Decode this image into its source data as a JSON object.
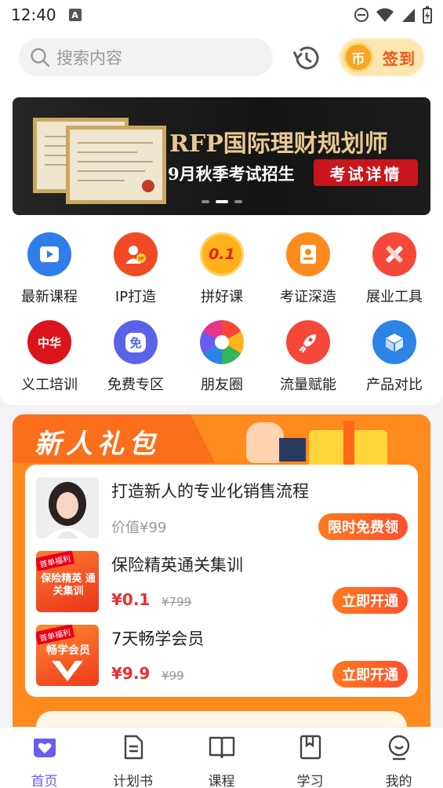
{
  "status_bar": {
    "time": "12:40",
    "notification_letter": "A"
  },
  "header": {
    "search_placeholder": "搜索内容",
    "checkin": {
      "coin_label": "币",
      "label": "签到"
    }
  },
  "banner": {
    "title": "RFP国际理财规划师",
    "subtitle": "9月秋季考试招生",
    "button_label": "考试详情",
    "active_slide": 2,
    "slide_count": 3
  },
  "quick_entries": [
    {
      "label": "最新课程",
      "icon": "play-video-icon",
      "color": "#2f7de8"
    },
    {
      "label": "IP打造",
      "icon": "ip-person-icon",
      "color": "#f14a24"
    },
    {
      "label": "拼好课",
      "icon": "discount-0.1-icon",
      "icon_text": "0.1",
      "color": "#ffb21a"
    },
    {
      "label": "考证深造",
      "icon": "certificate-icon",
      "color": "#ff8a1e"
    },
    {
      "label": "展业工具",
      "icon": "tools-icon",
      "color": "#f5483a"
    },
    {
      "label": "义工培训",
      "icon": "volunteer-logo-icon",
      "icon_text": "中华",
      "color": "#d9141b"
    },
    {
      "label": "免费专区",
      "icon": "free-chat-icon",
      "icon_text": "免",
      "color": "#5a63e8"
    },
    {
      "label": "朋友圈",
      "icon": "aperture-icon",
      "color": "#34b45a"
    },
    {
      "label": "流量赋能",
      "icon": "rocket-icon",
      "color": "#f5483a"
    },
    {
      "label": "产品对比",
      "icon": "cube-icon",
      "color": "#2c84e6"
    }
  ],
  "promo": {
    "title": "新人礼包",
    "items": [
      {
        "title": "打造新人的专业化销售流程",
        "price_text": "价值¥99",
        "button": "限时免费领",
        "thumb": "avatar-woman"
      },
      {
        "title": "保险精英通关集训",
        "price": "¥0.1",
        "original_price": "¥799",
        "button": "立即开通",
        "thumb_badge": "首单福利",
        "thumb_text": "保险精英 通关集训"
      },
      {
        "title": "7天畅学会员",
        "price": "¥9.9",
        "original_price": "¥99",
        "button": "立即开通",
        "thumb_badge": "首单福利",
        "thumb_text": "畅学会员"
      }
    ]
  },
  "bottom_nav": [
    {
      "label": "首页",
      "icon": "home-heart-icon",
      "active": true
    },
    {
      "label": "计划书",
      "icon": "document-icon",
      "active": false
    },
    {
      "label": "课程",
      "icon": "book-icon",
      "active": false
    },
    {
      "label": "学习",
      "icon": "bookmark-icon",
      "active": false
    },
    {
      "label": "我的",
      "icon": "profile-icon",
      "active": false
    }
  ],
  "colors": {
    "accent": "#ff8a1e",
    "nav_active": "#6a5cf0",
    "price": "#f02d2d"
  }
}
